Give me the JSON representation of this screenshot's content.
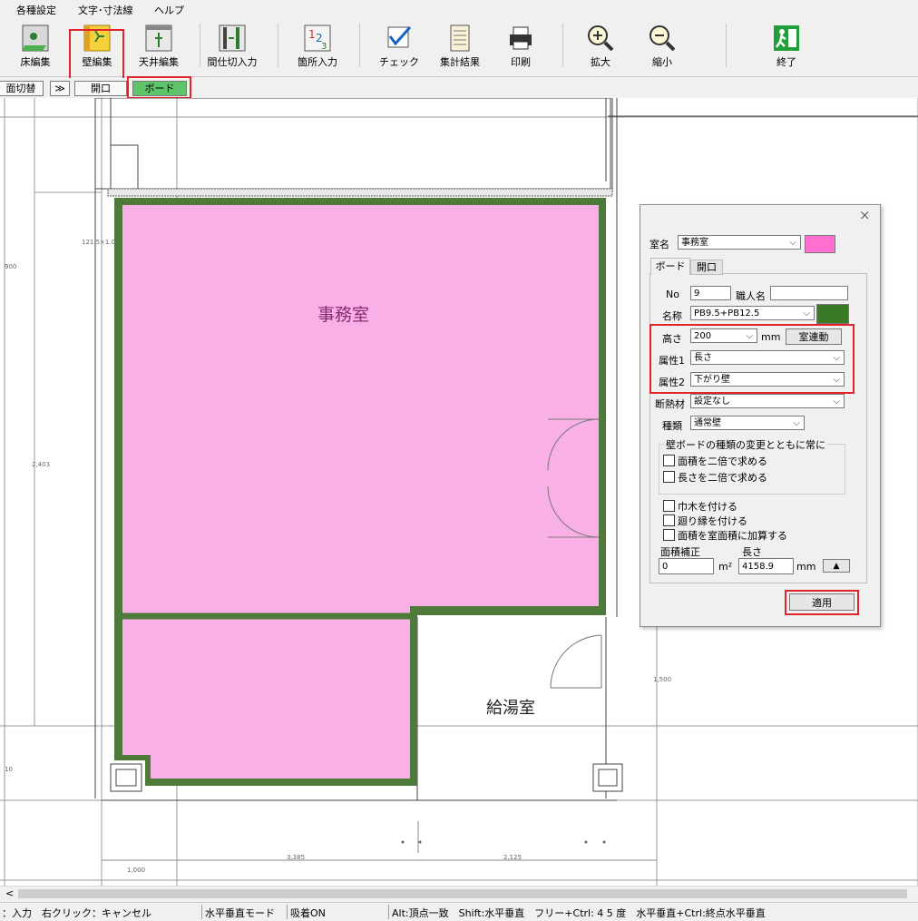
{
  "menu": [
    "各種設定",
    "文字･寸法線",
    "ヘルプ"
  ],
  "toolbar": {
    "items": [
      {
        "label": "床編集",
        "icon": "floor-edit-icon"
      },
      {
        "label": "壁編集",
        "icon": "wall-edit-icon"
      },
      {
        "label": "天井編集",
        "icon": "ceiling-edit-icon"
      },
      {
        "label": "間仕切入力",
        "icon": "partition-input-icon"
      },
      {
        "label": "箇所入力",
        "icon": "location-input-icon"
      },
      {
        "label": "チェック",
        "icon": "check-icon"
      },
      {
        "label": "集計結果",
        "icon": "tally-result-icon"
      },
      {
        "label": "印刷",
        "icon": "print-icon"
      },
      {
        "label": "拡大",
        "icon": "zoom-in-icon"
      },
      {
        "label": "縮小",
        "icon": "zoom-out-icon"
      },
      {
        "label": "終了",
        "icon": "exit-icon"
      }
    ]
  },
  "subtabs": {
    "screen_switch": "面切替",
    "expand": "≫",
    "opening": "開口",
    "board": "ボード"
  },
  "drawing": {
    "rooms": {
      "office": "事務室",
      "kitchenette": "給湯室"
    },
    "dims": {
      "top_left": "121.5×1.0",
      "left_upper": "900",
      "left_mid": "2,403",
      "left_lower": "10",
      "right": "1,500",
      "bottom_1": "1,000",
      "bottom_2": "3,385",
      "bottom_3": "2,125"
    }
  },
  "panel": {
    "close": "×",
    "room_label": "室名",
    "room_value": "事務室",
    "room_color": "#ff70d0",
    "tabs": {
      "board": "ボード",
      "opening": "開口"
    },
    "no_label": "No",
    "no_value": "9",
    "worker_label": "職人名",
    "worker_value": "",
    "name_label": "名称",
    "name_value": "PB9.5+PB12.5",
    "name_color": "#3a7a26",
    "height_label": "高さ",
    "height_value": "200",
    "height_unit": "mm",
    "room_link_btn": "室連動",
    "attr1_label": "属性1",
    "attr1_value": "長さ",
    "attr2_label": "属性2",
    "attr2_value": "下がり壁",
    "insulation_label": "断熱材",
    "insulation_value": "設定なし",
    "type_label": "種類",
    "type_value": "通常壁",
    "group_title": "壁ボードの種類の変更とともに常に",
    "cb_area_double": "面積を二倍で求める",
    "cb_length_double": "長さを二倍で求める",
    "cb_baseboard": "巾木を付ける",
    "cb_molding": "廻り縁を付ける",
    "cb_add_area": "面積を室面積に加算する",
    "area_corr_label": "面積補正",
    "area_corr_value": "0",
    "area_unit": "m²",
    "length_label": "長さ",
    "length_value": "4158.9",
    "length_unit": "mm",
    "up_btn": "▲",
    "apply_btn": "適用"
  },
  "status": {
    "hint": "：入力　右クリック：キャンセル",
    "mode": "水平垂直モード",
    "snap": "吸着ON",
    "keys": "Alt:頂点一致　Shift:水平垂直　フリー+Ctrl: 4 5 度　水平垂直+Ctrl:終点水平垂直"
  },
  "scroll_left": "<",
  "colors": {
    "room_fill": "#f9b0e6",
    "wall": "#4e7a3c",
    "highlight": "#e0242a",
    "board_tab": "#5ec46a"
  }
}
